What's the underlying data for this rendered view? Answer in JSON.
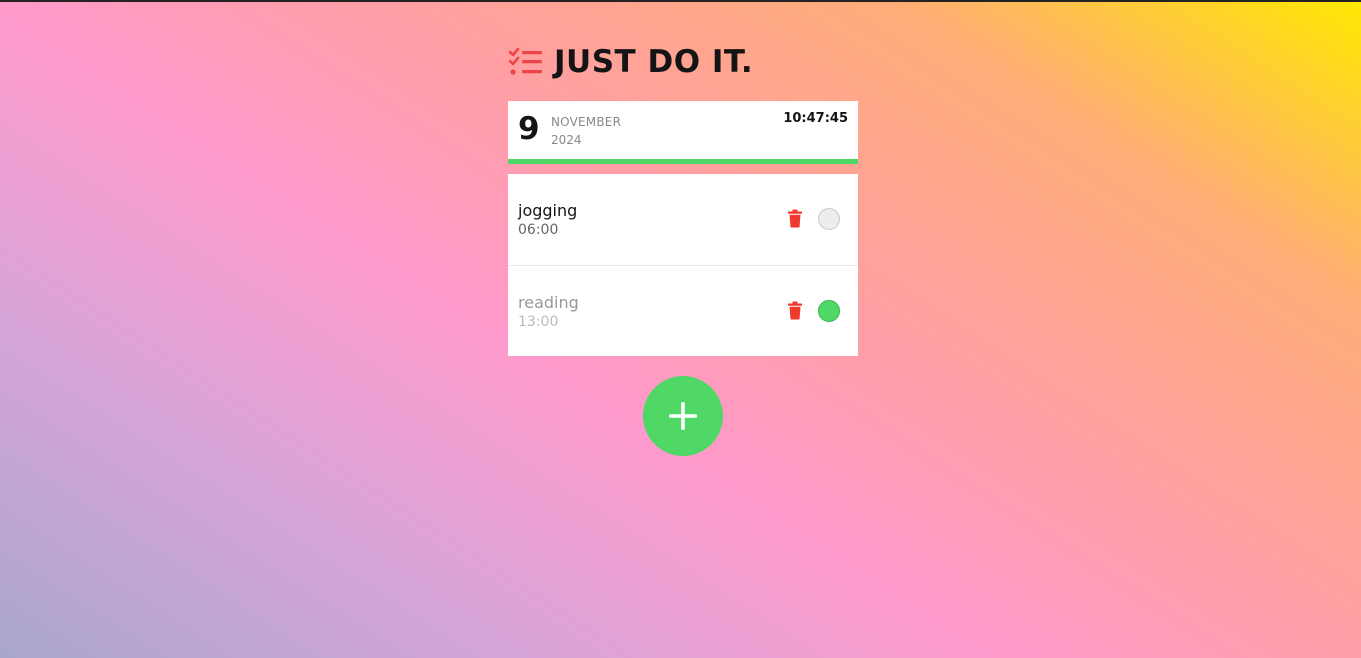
{
  "header": {
    "title": "JUST DO IT.",
    "icon": "checklist-icon"
  },
  "date": {
    "day": "9",
    "month": "NOVEMBER",
    "year": "2024",
    "time": "10:47:45"
  },
  "tasks": [
    {
      "name": "jogging",
      "time": "06:00",
      "done": false
    },
    {
      "name": "reading",
      "time": "13:00",
      "done": true
    }
  ],
  "actions": {
    "add_icon": "plus-icon",
    "delete_icon": "trash-icon"
  },
  "colors": {
    "accent_green": "#4fd865",
    "delete_red": "#ef3b2d",
    "logo_red": "#ef4444"
  }
}
